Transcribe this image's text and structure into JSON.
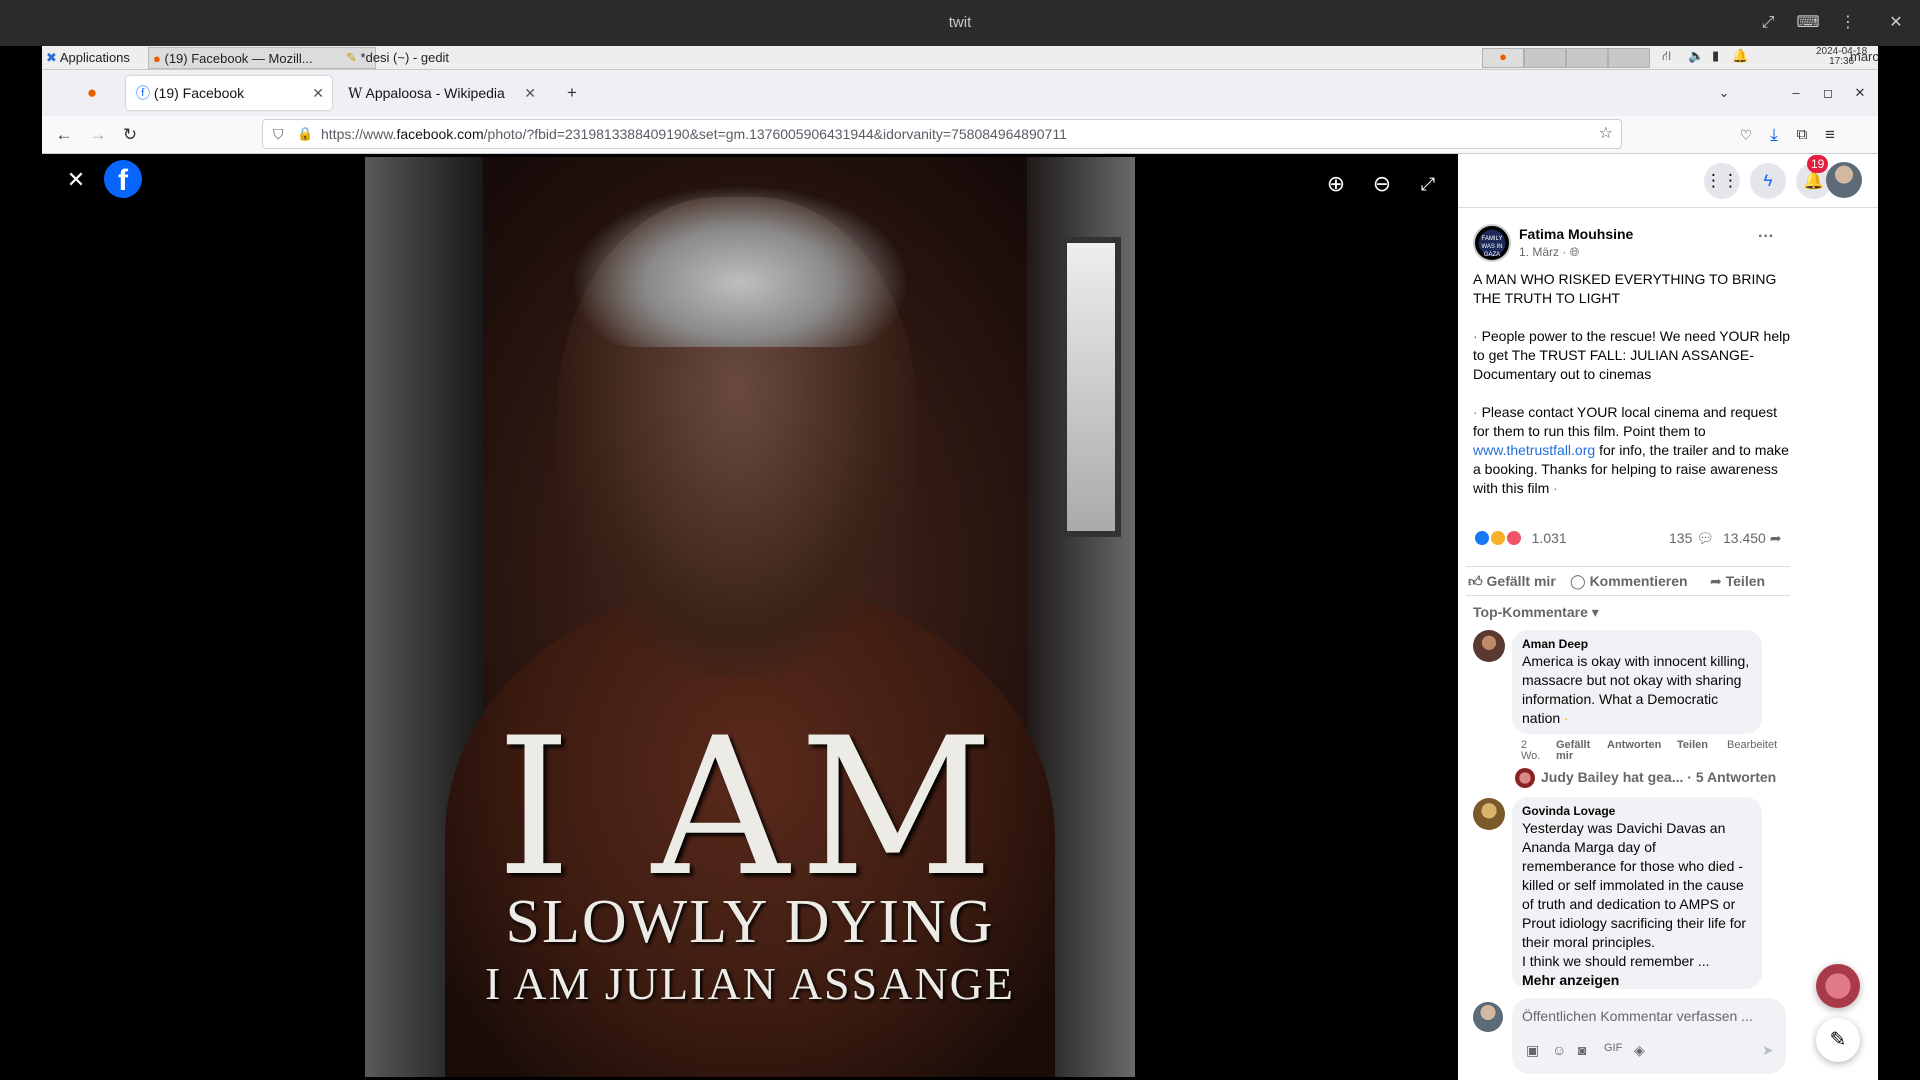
{
  "remote_window": {
    "title": "twit"
  },
  "taskbar": {
    "applications_label": "Applications",
    "tasks": [
      {
        "label": "(19) Facebook — Mozill..."
      },
      {
        "label": "*desi (~) - gedit"
      }
    ],
    "clock_date": "2024-04-18",
    "clock_time": "17:36",
    "user": "marc"
  },
  "browser": {
    "tabs": [
      {
        "label": "(19) Facebook"
      },
      {
        "label": "Appaloosa - Wikipedia"
      }
    ],
    "url_prefix": "https://www.",
    "url_domain": "facebook.com",
    "url_rest": "/photo/?fbid=2319813388409190&set=gm.1376005906431944&idorvanity=758084964890711"
  },
  "photo": {
    "line1": "I AM",
    "line2": "SLOWLY DYING",
    "line3": "I AM JULIAN ASSANGE"
  },
  "header": {
    "notification_count": "19"
  },
  "post": {
    "author": "Fatima Mouhsine",
    "date": "1. März ·",
    "avatar_text": "FAMILY WAS IN GAZA",
    "para1": "A MAN WHO RISKED EVERYTHING TO BRING THE TRUTH TO LIGHT",
    "para2": "People power to the rescue! We need YOUR help to get The TRUST FALL: JULIAN ASSANGE- Documentary out to cinemas",
    "para3_a": "Please contact YOUR local cinema and request for them to run this film. Point them to",
    "para3_link": "www.thetrustfall.org",
    "para3_b": "for info, the trailer and to make a booking. Thanks for helping to raise awareness with this film",
    "reactions_count": "1.031",
    "comments_count": "135",
    "shares_count": "13.450",
    "like_label": "Gefällt mir",
    "comment_label": "Kommentieren",
    "share_label": "Teilen",
    "sort_label": "Top-Kommentare"
  },
  "comments": [
    {
      "author": "Aman Deep",
      "text": "America is okay with innocent killing, massacre but not okay with sharing information. What a Democratic nation",
      "time": "2 Wo.",
      "like": "Gefällt mir",
      "reply": "Antworten",
      "share": "Teilen",
      "edited": "Bearbeitet",
      "replies_summary": "Judy Bailey hat gea...",
      "replies_count": "· 5 Antworten"
    },
    {
      "author": "Govinda Lovage",
      "text": "Yesterday was Davichi Davas an Ananda Marga day of rememberance for those who died - killed or self immolated in the cause of truth and dedication to AMPS or Prout idiology sacrificing their life for their moral principles.",
      "text2": "I think we should remember ...",
      "more": "Mehr anzeigen"
    }
  ],
  "composer": {
    "placeholder": "Öffentlichen Kommentar verfassen ..."
  },
  "colors": {
    "fb_blue": "#0866ff",
    "badge_red": "#e41e3f"
  }
}
